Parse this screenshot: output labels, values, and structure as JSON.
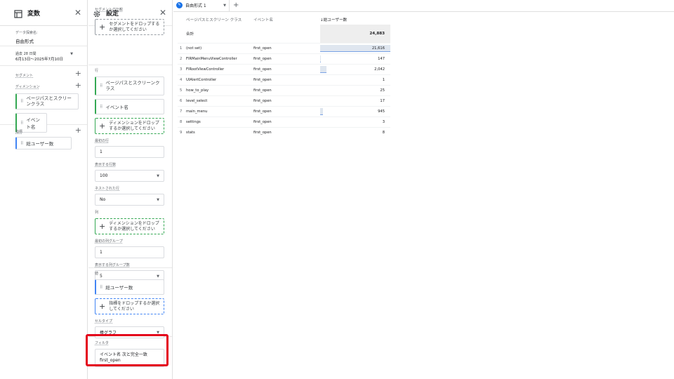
{
  "variables": {
    "title": "変数",
    "close": "✕",
    "exploration_name_label": "データ探索名:",
    "exploration_name": "自由形式",
    "date_label": "過去 28 日間",
    "date_range": "6月13日～2025年7月10日",
    "segments_label": "セグメント",
    "dimensions_label": "ディメンション",
    "dimensions": [
      "ページパスとスクリーンクラス",
      "イベント名"
    ],
    "metrics_label": "指標",
    "metrics": [
      "総ユーザー数"
    ]
  },
  "settings": {
    "title": "設定",
    "close": "✕",
    "segment_compare_label": "セグメントの比較",
    "segment_drop": "セグメントをドロップするか選択してください",
    "rows_label": "行",
    "rows": [
      "ページパスとスクリーンクラス",
      "イベント名"
    ],
    "row_drop": "ディメンションをドロップするか選択してください",
    "start_row_label": "最初の行",
    "start_row": "1",
    "show_rows_label": "表示する行数",
    "show_rows": "100",
    "nested_rows_label": "ネストされた行",
    "nested_rows": "No",
    "columns_label": "列",
    "column_drop": "ディメンションをドロップするか選択してください",
    "start_col_group_label": "最初の列グループ",
    "start_col_group": "1",
    "show_col_groups_label": "表示する列グループ数",
    "show_col_groups": "5",
    "values_label": "値",
    "values": [
      "総ユーザー数"
    ],
    "metric_drop": "指標をドロップするか選択してください",
    "cell_type_label": "セルタイプ",
    "cell_type": "棒グラフ",
    "filter_label": "フィルタ",
    "filter_line1": "イベント名 次と完全一致",
    "filter_line2": "first_open"
  },
  "canvas": {
    "tab_label": "自由形式 1",
    "tab_caret": "▼",
    "add_tab": "+",
    "headers": [
      "ページパスとスクリーン クラス",
      "イベント名",
      "↓総ユーザー数"
    ],
    "total_label": "合計",
    "total_value": "24,883",
    "rows": [
      {
        "n": "1",
        "page": "(not set)",
        "event": "first_open",
        "value": "21,616",
        "v": 21616
      },
      {
        "n": "2",
        "page": "FIRMainMenuViewController",
        "event": "first_open",
        "value": "147",
        "v": 147
      },
      {
        "n": "3",
        "page": "FIRootViewController",
        "event": "first_open",
        "value": "2,042",
        "v": 2042
      },
      {
        "n": "4",
        "page": "UIAlertController",
        "event": "first_open",
        "value": "1",
        "v": 1
      },
      {
        "n": "5",
        "page": "how_to_play",
        "event": "first_open",
        "value": "25",
        "v": 25
      },
      {
        "n": "6",
        "page": "level_select",
        "event": "first_open",
        "value": "17",
        "v": 17
      },
      {
        "n": "7",
        "page": "main_menu",
        "event": "first_open",
        "value": "945",
        "v": 945
      },
      {
        "n": "8",
        "page": "settings",
        "event": "first_open",
        "value": "3",
        "v": 3
      },
      {
        "n": "9",
        "page": "stats",
        "event": "first_open",
        "value": "8",
        "v": 8
      }
    ]
  },
  "colors": {
    "accent": "#1a73e8",
    "highlight": "#e4001b",
    "dimension": "#34a853",
    "metric": "#4285f4"
  }
}
